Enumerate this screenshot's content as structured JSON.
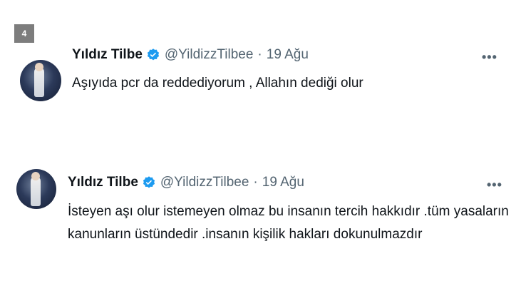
{
  "image_number": "4",
  "tweets": [
    {
      "name": "Yıldız Tilbe",
      "handle": "@YildizzTilbee",
      "separator": "·",
      "date": "19 Ağu",
      "more": "•••",
      "verified_icon": "verified-badge-icon",
      "lines": [
        "Aşıyıda pcr da reddediyorum , Allahın dediği olur"
      ]
    },
    {
      "name": "Yıldız Tilbe",
      "handle": "@YildizzTilbee",
      "separator": "·",
      "date": "19 Ağu",
      "more": "•••",
      "verified_icon": "verified-badge-icon",
      "lines": [
        "İsteyen aşı olur istemeyen olmaz bu insanın tercih hakkıdır .tüm yasaların",
        "kanunların üstündedir .insanın kişilik hakları dokunulmazdır"
      ]
    }
  ],
  "colors": {
    "verified": "#1d9bf0",
    "secondary_text": "#536471",
    "badge_bg": "#7d7d7d"
  }
}
